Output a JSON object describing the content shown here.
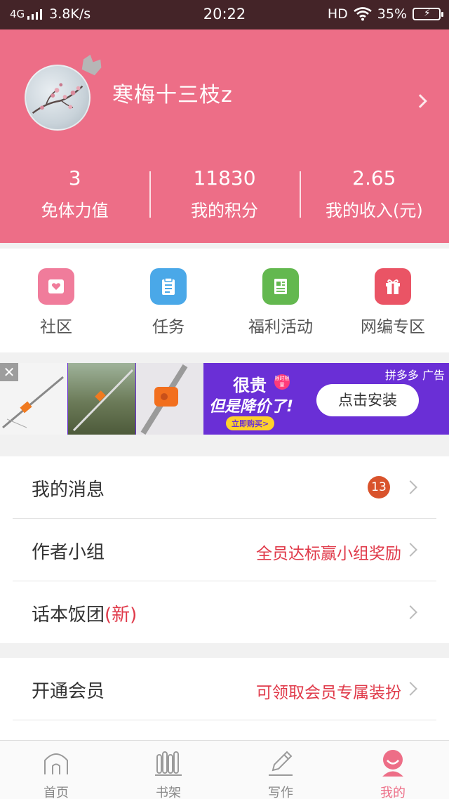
{
  "status_bar": {
    "network": "4G",
    "speed": "3.8K/s",
    "time": "20:22",
    "hd": "HD",
    "battery": "35%"
  },
  "profile": {
    "username": "寒梅十三枝z",
    "stats": [
      {
        "value": "3",
        "label": "免体力值"
      },
      {
        "value": "11830",
        "label": "我的积分"
      },
      {
        "value": "2.65",
        "label": "我的收入(元)"
      }
    ]
  },
  "quick_nav": [
    {
      "label": "社区",
      "icon": "community-icon",
      "color": "#f07c9b"
    },
    {
      "label": "任务",
      "icon": "task-icon",
      "color": "#4aa8e8"
    },
    {
      "label": "福利活动",
      "icon": "welfare-icon",
      "color": "#63b84f"
    },
    {
      "label": "网编专区",
      "icon": "gift-icon",
      "color": "#ea5465"
    }
  ],
  "ad": {
    "slogan_1": "很贵",
    "tag": "限时限量",
    "slogan_2": "但是降价了!",
    "buy": "立即购买>",
    "button": "点击安装",
    "brand": "拼多多  广告",
    "close": "✕"
  },
  "menu_group_1": [
    {
      "title": "我的消息",
      "badge": "13"
    },
    {
      "title": "作者小组",
      "right": "全员达标赢小组奖励"
    },
    {
      "title": "话本饭团",
      "title_suffix": "(新)"
    }
  ],
  "menu_group_2": [
    {
      "title": "开通会员",
      "right": "可领取会员专属装扮"
    }
  ],
  "tab_bar": [
    {
      "label": "首页",
      "icon": "home-icon"
    },
    {
      "label": "书架",
      "icon": "bookshelf-icon"
    },
    {
      "label": "写作",
      "icon": "write-icon"
    },
    {
      "label": "我的",
      "icon": "me-icon",
      "active": true
    }
  ],
  "colors": {
    "header_bg": "#ed6e87",
    "accent_red": "#e03a4a",
    "status_bar_bg": "#442428"
  }
}
